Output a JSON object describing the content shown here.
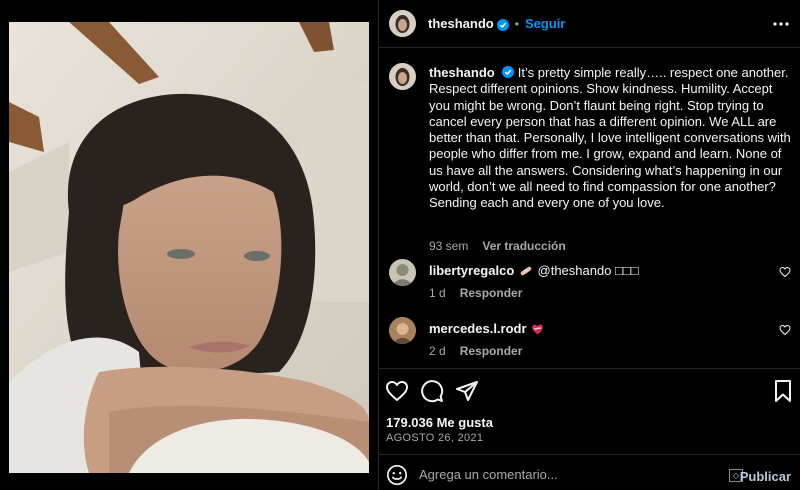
{
  "header": {
    "username": "theshando",
    "dot": "•",
    "follow_label": "Seguir"
  },
  "caption": {
    "username": "theshando",
    "text": "It’s pretty simple really….. respect one another. Respect different opinions. Show kindness. Humility. Accept you might be wrong. Don’t flaunt being right. Stop trying to cancel every person that has a different opinion. We ALL are better than that. Personally, I love intelligent conversations with people who differ from me. I grow, expand and learn. None of us have all the answers. Considering what’s happening in our world, don’t we all need to find compassion for one another? Sending each and every one of you love.",
    "time": "93 sem",
    "translate_label": "Ver traducción"
  },
  "comments": [
    {
      "username": "libertyregalco",
      "text": "@theshando □□□",
      "emoji": "bandage-emoji",
      "time": "1 d",
      "reply_label": "Responder"
    },
    {
      "username": "mercedes.l.rodr",
      "text": "",
      "emoji": "mending-heart-emoji",
      "time": "2 d",
      "reply_label": "Responder"
    }
  ],
  "stats": {
    "likes": "179.036 Me gusta",
    "date": "AGOSTO 26, 2021"
  },
  "add_comment": {
    "placeholder": "Agrega un comentario...",
    "publish_label": "Publicar",
    "caret": "◇"
  },
  "colors": {
    "accent": "#0095f6",
    "background": "#000000",
    "text": "#f5f5f5",
    "muted": "#a8a8a8",
    "publish_disabled": "#b8c7d6"
  }
}
